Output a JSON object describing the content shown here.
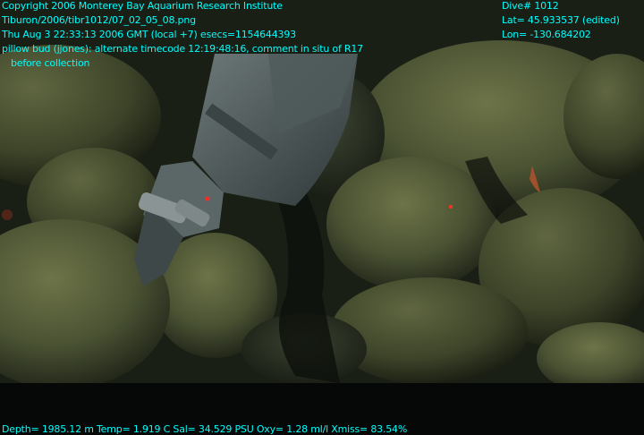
{
  "overlay": {
    "copyright": "Copyright 2006 Monterey Bay Aquarium Research Institute",
    "file_path": "Tiburon/2006/tibr1012/07_02_05_08.png",
    "timestamp": "Thu Aug  3 22:33:13 2006 GMT (local +7)  esecs=1154644393",
    "comment": "pillow bud (jjones): alternate timecode 12:19:48:16, comment in situ of R17",
    "note": "before collection",
    "dive": "Dive# 1012",
    "lat": "Lat= 45.933537 (edited)",
    "lon": "Lon= -130.684202",
    "sensors": "Depth= 1985.12 m  Temp= 1.919 C  Sal= 34.529 PSU  Oxy= 1.28 ml/l  Xmiss= 83.54%"
  },
  "colors": {
    "overlay_text": "#00ffff",
    "background": "#000000"
  }
}
